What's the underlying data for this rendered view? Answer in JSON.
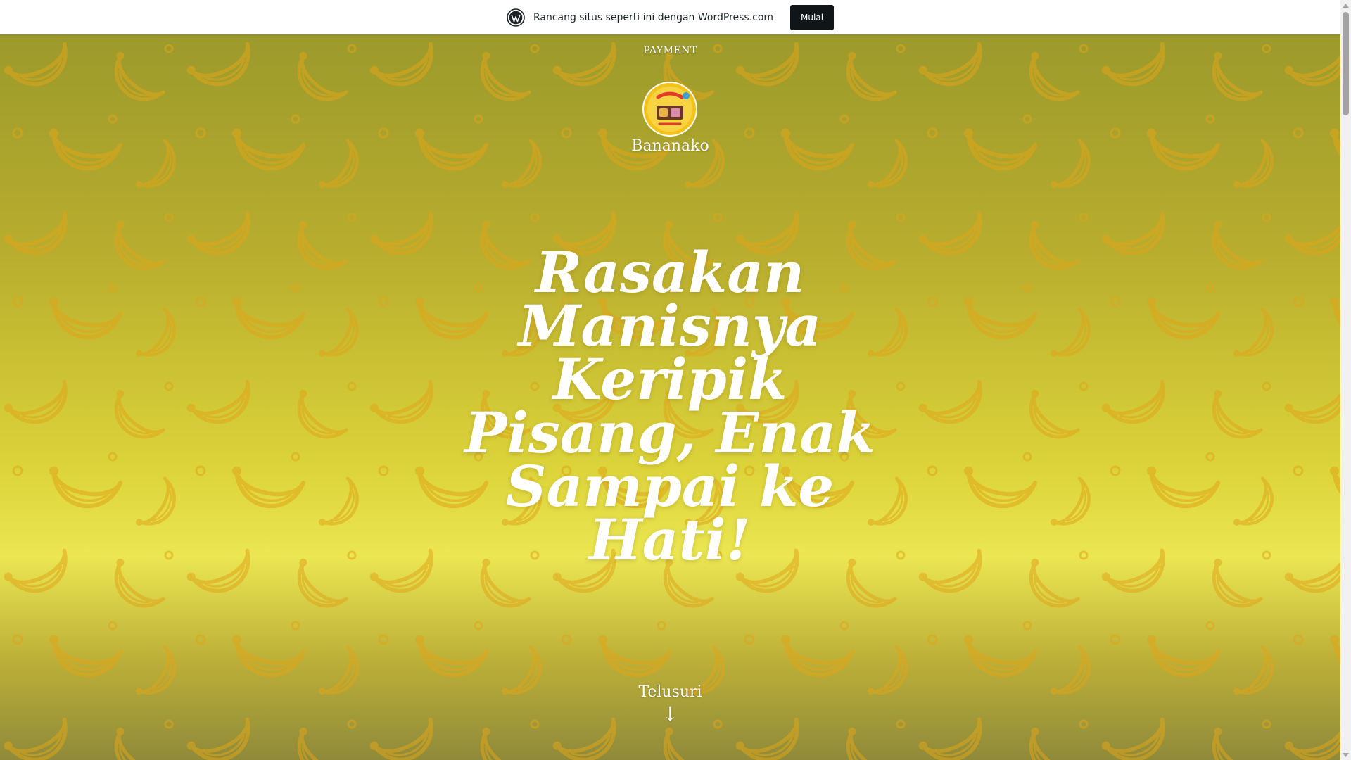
{
  "wp_banner": {
    "text": "Rancang situs seperti ini dengan WordPress.com",
    "button_label": "Mulai",
    "logo_icon": "wordpress-logo-icon"
  },
  "header": {
    "menu_item": "PAYMENT",
    "site_title": "Bananako",
    "logo_icon": "site-logo-icon"
  },
  "hero": {
    "heading": "Rasakan Manisnya Keripik Pisang, Enak Sampai ke Hati!",
    "explore_label": "Telusuri",
    "explore_arrow": "↓"
  },
  "colors": {
    "background": "#c8b82a",
    "banana_outline": "#e3a50f",
    "button": "#101517",
    "text_light": "#ffffff"
  }
}
